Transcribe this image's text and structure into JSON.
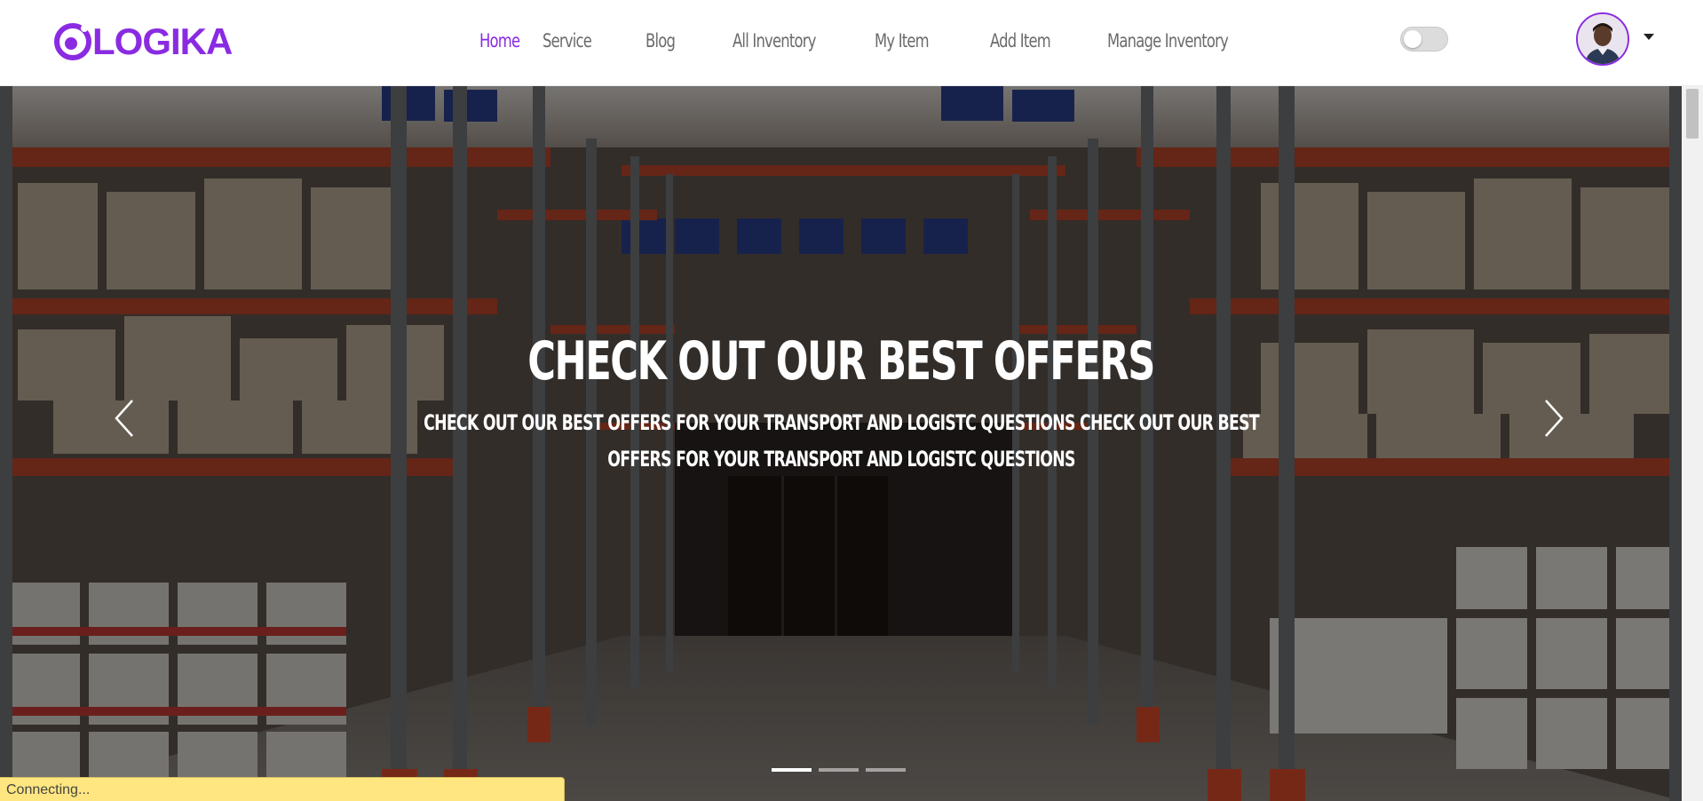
{
  "brand": {
    "name": "LOGIKA",
    "color": "#8a2be2"
  },
  "nav": {
    "items": [
      {
        "label": "Home",
        "active": true
      },
      {
        "label": "Service",
        "active": false
      },
      {
        "label": "Blog",
        "active": false
      },
      {
        "label": "All Inventory",
        "active": false
      },
      {
        "label": "My Item",
        "active": false
      },
      {
        "label": "Add Item",
        "active": false
      },
      {
        "label": "Manage Inventory",
        "active": false
      }
    ],
    "theme_toggle": "off"
  },
  "user": {
    "avatar_icon": "user-avatar"
  },
  "hero": {
    "title": "CHECK OUT OUR BEST OFFERS",
    "subtitle": "CHECK OUT OUR BEST OFFERS FOR YOUR TRANSPORT AND LOGISTC QUESTIONS CHECK OUT OUR BEST OFFERS FOR YOUR TRANSPORT AND LOGISTC QUESTIONS",
    "prev_icon": "chevron-left-icon",
    "next_icon": "chevron-right-icon",
    "slide_count": 3,
    "active_slide": 1
  },
  "status": {
    "text": "Connecting..."
  }
}
